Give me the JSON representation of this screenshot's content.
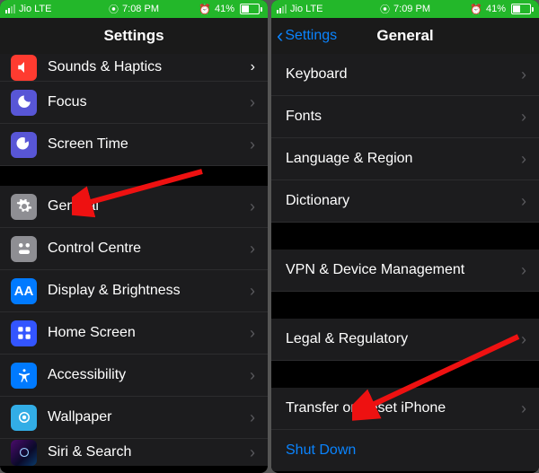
{
  "left": {
    "status": {
      "carrier": "Jio  LTE",
      "time": "7:08 PM",
      "battery_pct": "41%"
    },
    "nav": {
      "title": "Settings"
    },
    "rows": [
      {
        "icon": "sounds",
        "label": "Sounds & Haptics"
      },
      {
        "icon": "focus",
        "label": "Focus"
      },
      {
        "icon": "screentime",
        "label": "Screen Time"
      }
    ],
    "rows2": [
      {
        "icon": "general",
        "label": "General"
      },
      {
        "icon": "control",
        "label": "Control Centre"
      },
      {
        "icon": "display",
        "label": "Display & Brightness"
      },
      {
        "icon": "home",
        "label": "Home Screen"
      },
      {
        "icon": "accessibility",
        "label": "Accessibility"
      },
      {
        "icon": "wallpaper",
        "label": "Wallpaper"
      },
      {
        "icon": "siri",
        "label": "Siri & Search"
      }
    ]
  },
  "right": {
    "status": {
      "carrier": "Jio  LTE",
      "time": "7:09 PM",
      "battery_pct": "41%"
    },
    "nav": {
      "back": "Settings",
      "title": "General"
    },
    "group1": [
      {
        "label": "Keyboard"
      },
      {
        "label": "Fonts"
      },
      {
        "label": "Language & Region"
      },
      {
        "label": "Dictionary"
      }
    ],
    "group2": [
      {
        "label": "VPN & Device Management"
      }
    ],
    "group3": [
      {
        "label": "Legal & Regulatory"
      }
    ],
    "group4": [
      {
        "label": "Transfer or Reset iPhone"
      }
    ],
    "shutdown": "Shut Down"
  }
}
